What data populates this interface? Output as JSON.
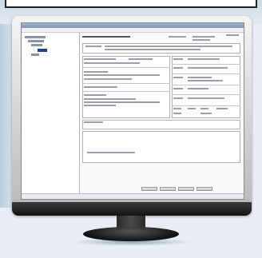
{
  "window": {
    "title": "",
    "status": ""
  },
  "buttons": [
    "",
    "",
    "",
    ""
  ],
  "colors": {
    "accent": "#1f3f8f",
    "background": "#e8eef4"
  }
}
